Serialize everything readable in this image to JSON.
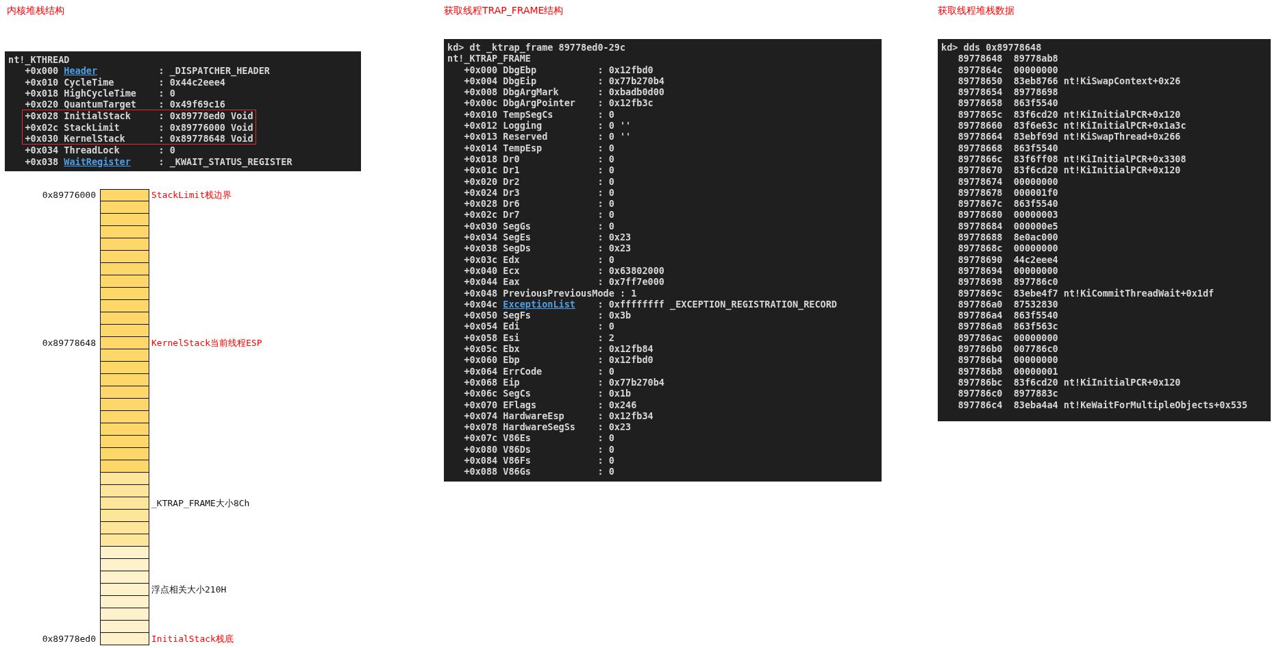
{
  "sections": [
    {
      "title": "内核堆栈结构",
      "terminal": {
        "lines": [
          {
            "kind": "text",
            "text": "nt!_KTHREAD"
          },
          {
            "kind": "field",
            "offset": "+0x000",
            "name": "Header",
            "value": ": _DISPATCHER_HEADER",
            "link": true,
            "highlighted": false
          },
          {
            "kind": "field",
            "offset": "+0x010",
            "name": "CycleTime",
            "value": ": 0x44c2eee4",
            "link": false,
            "highlighted": false
          },
          {
            "kind": "field",
            "offset": "+0x018",
            "name": "HighCycleTime",
            "value": ": 0",
            "link": false,
            "highlighted": false
          },
          {
            "kind": "field",
            "offset": "+0x020",
            "name": "QuantumTarget",
            "value": ": 0x49f69c16",
            "link": false,
            "highlighted": false
          },
          {
            "kind": "field",
            "offset": "+0x028",
            "name": "InitialStack",
            "value": ": 0x89778ed0 Void",
            "link": false,
            "highlighted": true
          },
          {
            "kind": "field",
            "offset": "+0x02c",
            "name": "StackLimit",
            "value": ": 0x89776000 Void",
            "link": false,
            "highlighted": true
          },
          {
            "kind": "field",
            "offset": "+0x030",
            "name": "KernelStack",
            "value": ": 0x89778648 Void",
            "link": false,
            "highlighted": true
          },
          {
            "kind": "field",
            "offset": "+0x034",
            "name": "ThreadLock",
            "value": ": 0",
            "link": false,
            "highlighted": false
          },
          {
            "kind": "field",
            "offset": "+0x038",
            "name": "WaitRegister",
            "value": ": _KWAIT_STATUS_REGISTER",
            "link": true,
            "highlighted": false
          }
        ]
      },
      "stack_diagram": {
        "cells": [
          {
            "color": "#fdd868",
            "address": "0x89776000",
            "note": "StackLimit栈边界",
            "kind": "marker"
          },
          {
            "color": "#fdd868"
          },
          {
            "color": "#fdd868"
          },
          {
            "color": "#fdd868"
          },
          {
            "color": "#fdd868"
          },
          {
            "color": "#fdd868"
          },
          {
            "color": "#fdd868"
          },
          {
            "color": "#fdd868"
          },
          {
            "color": "#fdd868"
          },
          {
            "color": "#fdd868"
          },
          {
            "color": "#fdd868"
          },
          {
            "color": "#fdd868"
          },
          {
            "color": "#fdd868",
            "address": "0x89778648",
            "note": "KernelStack当前线程ESP",
            "kind": "marker"
          },
          {
            "color": "#fdd868"
          },
          {
            "color": "#fdd868"
          },
          {
            "color": "#fdd868"
          },
          {
            "color": "#fdd868"
          },
          {
            "color": "#fdd868"
          },
          {
            "color": "#fdd868"
          },
          {
            "color": "#fdd868"
          },
          {
            "color": "#fdd868"
          },
          {
            "color": "#fdd868"
          },
          {
            "color": "#fdd868"
          },
          {
            "color": "#fde59a"
          },
          {
            "color": "#fde59a"
          },
          {
            "color": "#fde59a",
            "note": "_KTRAP_FRAME大小8Ch",
            "kind": "info"
          },
          {
            "color": "#fde59a"
          },
          {
            "color": "#fde59a"
          },
          {
            "color": "#fde59a"
          },
          {
            "color": "#fef2cc"
          },
          {
            "color": "#fef2cc"
          },
          {
            "color": "#fef2cc"
          },
          {
            "color": "#fef2cc",
            "note": "浮点相关大小210H",
            "kind": "info"
          },
          {
            "color": "#fef2cc"
          },
          {
            "color": "#fef2cc"
          },
          {
            "color": "#fef2cc"
          },
          {
            "color": "#fef2cc",
            "address": "0x89778ed0",
            "note": "InitialStack栈底",
            "kind": "marker"
          }
        ]
      }
    },
    {
      "title": "获取线程TRAP_FRAME结构",
      "terminal": {
        "lines": [
          {
            "kind": "text",
            "text": "kd> dt _ktrap_frame 89778ed0-29c"
          },
          {
            "kind": "text",
            "text": "nt!_KTRAP_FRAME"
          },
          {
            "kind": "field",
            "offset": "+0x000",
            "name": "DbgEbp",
            "value": ": 0x12fbd0",
            "link": false
          },
          {
            "kind": "field",
            "offset": "+0x004",
            "name": "DbgEip",
            "value": ": 0x77b270b4",
            "link": false
          },
          {
            "kind": "field",
            "offset": "+0x008",
            "name": "DbgArgMark",
            "value": ": 0xbadb0d00",
            "link": false
          },
          {
            "kind": "field",
            "offset": "+0x00c",
            "name": "DbgArgPointer",
            "value": ": 0x12fb3c",
            "link": false
          },
          {
            "kind": "field",
            "offset": "+0x010",
            "name": "TempSegCs",
            "value": ": 0",
            "link": false
          },
          {
            "kind": "field",
            "offset": "+0x012",
            "name": "Logging",
            "value": ": 0 ''",
            "link": false
          },
          {
            "kind": "field",
            "offset": "+0x013",
            "name": "Reserved",
            "value": ": 0 ''",
            "link": false
          },
          {
            "kind": "field",
            "offset": "+0x014",
            "name": "TempEsp",
            "value": ": 0",
            "link": false
          },
          {
            "kind": "field",
            "offset": "+0x018",
            "name": "Dr0",
            "value": ": 0",
            "link": false
          },
          {
            "kind": "field",
            "offset": "+0x01c",
            "name": "Dr1",
            "value": ": 0",
            "link": false
          },
          {
            "kind": "field",
            "offset": "+0x020",
            "name": "Dr2",
            "value": ": 0",
            "link": false
          },
          {
            "kind": "field",
            "offset": "+0x024",
            "name": "Dr3",
            "value": ": 0",
            "link": false
          },
          {
            "kind": "field",
            "offset": "+0x028",
            "name": "Dr6",
            "value": ": 0",
            "link": false
          },
          {
            "kind": "field",
            "offset": "+0x02c",
            "name": "Dr7",
            "value": ": 0",
            "link": false
          },
          {
            "kind": "field",
            "offset": "+0x030",
            "name": "SegGs",
            "value": ": 0",
            "link": false
          },
          {
            "kind": "field",
            "offset": "+0x034",
            "name": "SegEs",
            "value": ": 0x23",
            "link": false
          },
          {
            "kind": "field",
            "offset": "+0x038",
            "name": "SegDs",
            "value": ": 0x23",
            "link": false
          },
          {
            "kind": "field",
            "offset": "+0x03c",
            "name": "Edx",
            "value": ": 0",
            "link": false
          },
          {
            "kind": "field",
            "offset": "+0x040",
            "name": "Ecx",
            "value": ": 0x63802000",
            "link": false
          },
          {
            "kind": "field",
            "offset": "+0x044",
            "name": "Eax",
            "value": ": 0x7ff7e000",
            "link": false
          },
          {
            "kind": "field",
            "offset": "+0x048",
            "name": "PreviousPreviousMode",
            "value": ": 1",
            "link": false
          },
          {
            "kind": "field",
            "offset": "+0x04c",
            "name": "ExceptionList",
            "value": ": 0xffffffff _EXCEPTION_REGISTRATION_RECORD",
            "link": true
          },
          {
            "kind": "field",
            "offset": "+0x050",
            "name": "SegFs",
            "value": ": 0x3b",
            "link": false
          },
          {
            "kind": "field",
            "offset": "+0x054",
            "name": "Edi",
            "value": ": 0",
            "link": false
          },
          {
            "kind": "field",
            "offset": "+0x058",
            "name": "Esi",
            "value": ": 2",
            "link": false
          },
          {
            "kind": "field",
            "offset": "+0x05c",
            "name": "Ebx",
            "value": ": 0x12fb84",
            "link": false
          },
          {
            "kind": "field",
            "offset": "+0x060",
            "name": "Ebp",
            "value": ": 0x12fbd0",
            "link": false
          },
          {
            "kind": "field",
            "offset": "+0x064",
            "name": "ErrCode",
            "value": ": 0",
            "link": false
          },
          {
            "kind": "field",
            "offset": "+0x068",
            "name": "Eip",
            "value": ": 0x77b270b4",
            "link": false
          },
          {
            "kind": "field",
            "offset": "+0x06c",
            "name": "SegCs",
            "value": ": 0x1b",
            "link": false
          },
          {
            "kind": "field",
            "offset": "+0x070",
            "name": "EFlags",
            "value": ": 0x246",
            "link": false
          },
          {
            "kind": "field",
            "offset": "+0x074",
            "name": "HardwareEsp",
            "value": ": 0x12fb34",
            "link": false
          },
          {
            "kind": "field",
            "offset": "+0x078",
            "name": "HardwareSegSs",
            "value": ": 0x23",
            "link": false
          },
          {
            "kind": "field",
            "offset": "+0x07c",
            "name": "V86Es",
            "value": ": 0",
            "link": false
          },
          {
            "kind": "field",
            "offset": "+0x080",
            "name": "V86Ds",
            "value": ": 0",
            "link": false
          },
          {
            "kind": "field",
            "offset": "+0x084",
            "name": "V86Fs",
            "value": ": 0",
            "link": false
          },
          {
            "kind": "field",
            "offset": "+0x088",
            "name": "V86Gs",
            "value": ": 0",
            "link": false
          }
        ]
      }
    },
    {
      "title": "获取线程堆栈数据",
      "terminal": {
        "lines": [
          {
            "kind": "text",
            "text": "kd> dds 0x89778648"
          },
          {
            "kind": "dump",
            "address": "89778648",
            "value": "89778ab8"
          },
          {
            "kind": "dump",
            "address": "8977864c",
            "value": "00000000"
          },
          {
            "kind": "dump",
            "address": "89778650",
            "value": "83eb8766",
            "symbol": "nt!KiSwapContext+0x26"
          },
          {
            "kind": "dump",
            "address": "89778654",
            "value": "89778698"
          },
          {
            "kind": "dump",
            "address": "89778658",
            "value": "863f5540"
          },
          {
            "kind": "dump",
            "address": "8977865c",
            "value": "83f6cd20",
            "symbol": "nt!KiInitialPCR+0x120"
          },
          {
            "kind": "dump",
            "address": "89778660",
            "value": "83f6e63c",
            "symbol": "nt!KiInitialPCR+0x1a3c"
          },
          {
            "kind": "dump",
            "address": "89778664",
            "value": "83ebf69d",
            "symbol": "nt!KiSwapThread+0x266"
          },
          {
            "kind": "dump",
            "address": "89778668",
            "value": "863f5540"
          },
          {
            "kind": "dump",
            "address": "8977866c",
            "value": "83f6ff08",
            "symbol": "nt!KiInitialPCR+0x3308"
          },
          {
            "kind": "dump",
            "address": "89778670",
            "value": "83f6cd20",
            "symbol": "nt!KiInitialPCR+0x120"
          },
          {
            "kind": "dump",
            "address": "89778674",
            "value": "00000000"
          },
          {
            "kind": "dump",
            "address": "89778678",
            "value": "000001f0"
          },
          {
            "kind": "dump",
            "address": "8977867c",
            "value": "863f5540"
          },
          {
            "kind": "dump",
            "address": "89778680",
            "value": "00000003"
          },
          {
            "kind": "dump",
            "address": "89778684",
            "value": "000000e5"
          },
          {
            "kind": "dump",
            "address": "89778688",
            "value": "8e0ac000"
          },
          {
            "kind": "dump",
            "address": "8977868c",
            "value": "00000000"
          },
          {
            "kind": "dump",
            "address": "89778690",
            "value": "44c2eee4"
          },
          {
            "kind": "dump",
            "address": "89778694",
            "value": "00000000"
          },
          {
            "kind": "dump",
            "address": "89778698",
            "value": "897786c0"
          },
          {
            "kind": "dump",
            "address": "8977869c",
            "value": "83ebe4f7",
            "symbol": "nt!KiCommitThreadWait+0x1df"
          },
          {
            "kind": "dump",
            "address": "897786a0",
            "value": "87532830"
          },
          {
            "kind": "dump",
            "address": "897786a4",
            "value": "863f5540"
          },
          {
            "kind": "dump",
            "address": "897786a8",
            "value": "863f563c"
          },
          {
            "kind": "dump",
            "address": "897786ac",
            "value": "00000000"
          },
          {
            "kind": "dump",
            "address": "897786b0",
            "value": "007786c0"
          },
          {
            "kind": "dump",
            "address": "897786b4",
            "value": "00000000"
          },
          {
            "kind": "dump",
            "address": "897786b8",
            "value": "00000001"
          },
          {
            "kind": "dump",
            "address": "897786bc",
            "value": "83f6cd20",
            "symbol": "nt!KiInitialPCR+0x120"
          },
          {
            "kind": "dump",
            "address": "897786c0",
            "value": "8977883c"
          },
          {
            "kind": "dump",
            "address": "897786c4",
            "value": "83eba4a4",
            "symbol": "nt!KeWaitForMultipleObjects+0x535"
          }
        ]
      }
    }
  ]
}
